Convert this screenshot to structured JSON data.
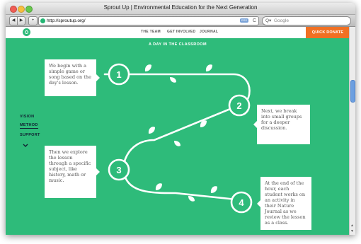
{
  "window": {
    "title": "Sprout Up | Environmental Education for the Next Generation"
  },
  "toolbar": {
    "back_glyph": "◀",
    "forward_glyph": "▶",
    "add_glyph": "+",
    "url": "http://sproutup.org/",
    "rss_label": "RSS",
    "reload_glyph": "C",
    "search_placeholder": "Google",
    "search_icon_glyph": "Q▾"
  },
  "site": {
    "nav": [
      "THE TEAM",
      "GET INVOLVED",
      "JOURNAL"
    ],
    "cta": "QUICK DONATE",
    "section_title": "A DAY IN THE CLASSROOM",
    "side_nav": [
      "VISION",
      "METHOD",
      "SUPPORT"
    ],
    "side_nav_active": "METHOD"
  },
  "steps": [
    {
      "number": "1",
      "text": "We begin with a simple game or song based on the day's lesson."
    },
    {
      "number": "2",
      "text": "Next, we break into small groups for a deeper discussion."
    },
    {
      "number": "3",
      "text": "Then we explore the lesson through a specific subject, like history, math or music."
    },
    {
      "number": "4",
      "text": "At the end of the hour, each student works on an activity in their Nature Journal as we review the lesson as a class."
    }
  ],
  "colors": {
    "background": "#2ebb7a",
    "accent": "#f07023",
    "path": "#ffffff"
  }
}
